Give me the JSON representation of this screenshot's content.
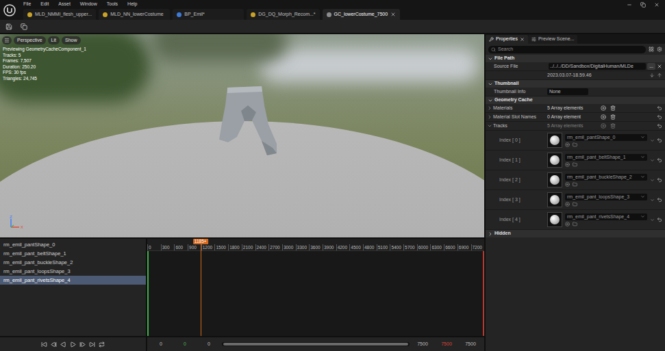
{
  "window": {
    "menu": [
      "File",
      "Edit",
      "Asset",
      "Window",
      "Tools",
      "Help"
    ]
  },
  "tabs": [
    {
      "label": "MLD_NMMI_flesh_upper...",
      "selected": false,
      "color": "#c9a227"
    },
    {
      "label": "MLD_NN_lowerCostume",
      "selected": false,
      "color": "#c9a227"
    },
    {
      "label": "BP_Emil*",
      "selected": false,
      "color": "#3d7bd6"
    },
    {
      "label": "DG_DQ_Morph_Recom...*",
      "selected": false,
      "color": "#c9a227"
    },
    {
      "label": "GC_lowerCostume_7500",
      "selected": true,
      "color": "#8c8c8c"
    }
  ],
  "viewport": {
    "buttons": [
      "Perspective",
      "Lit",
      "Show"
    ],
    "info": [
      "Previewing GeometryCacheComponent_1",
      "Tracks: 5",
      "Frames: 7,507",
      "Duration: 250.20",
      "FPS: 30 fps",
      "Triangles: 24,745"
    ],
    "axes": [
      {
        "label": "Z",
        "color": "#3b7cff"
      },
      {
        "label": "X",
        "color": "#e04b3b"
      }
    ]
  },
  "sequencer": {
    "tracks": [
      {
        "name": "rm_emil_pantShape_0",
        "selected": false
      },
      {
        "name": "rm_emil_pant_beltShape_1",
        "selected": false
      },
      {
        "name": "rm_emil_pant_buckleShape_2",
        "selected": false
      },
      {
        "name": "rm_emil_pant_loopsShape_3",
        "selected": false
      },
      {
        "name": "rm_emil_pant_rivetsShape_4",
        "selected": true
      }
    ],
    "ruler": [
      "0",
      "300",
      "600",
      "900",
      "1200",
      "1500",
      "1800",
      "2100",
      "2400",
      "2700",
      "3000",
      "3300",
      "3600",
      "3900",
      "4200",
      "4500",
      "4800",
      "5100",
      "5400",
      "5700",
      "6000",
      "6300",
      "6600",
      "6900",
      "7200"
    ],
    "playhead": {
      "label": "1185+",
      "level": 0.158
    },
    "range_start": [
      {
        "value": "0",
        "color": "#bdbdbd"
      },
      {
        "value": "0",
        "color": "#4caf50"
      },
      {
        "value": "0",
        "color": "#bdbdbd"
      }
    ],
    "range_end": [
      {
        "value": "7500",
        "color": "#bdbdbd"
      },
      {
        "value": "7500",
        "color": "#d9443a"
      },
      {
        "value": "7500",
        "color": "#bdbdbd"
      }
    ]
  },
  "details": {
    "tabs": [
      {
        "label": "Properties",
        "selected": true
      },
      {
        "label": "Preview Scene...",
        "selected": false
      }
    ],
    "search": {
      "placeholder": "Search"
    },
    "sections": [
      {
        "title": "File Path",
        "expanded": true,
        "rows": [
          {
            "kind": "file",
            "label": "Source File",
            "value": "../../../DD/Sandbox/DigitalHuman/MLDe",
            "button": "..."
          },
          {
            "kind": "timestamp",
            "value": "2023.03.07-18.59.46"
          }
        ]
      },
      {
        "title": "Thumbnail",
        "expanded": true,
        "rows": [
          {
            "kind": "text",
            "label": "Thumbnail Info",
            "value": "None"
          }
        ]
      },
      {
        "title": "Geometry Cache",
        "expanded": true,
        "rows": [
          {
            "kind": "array",
            "label": "Materials",
            "value": "5 Array elements",
            "expanded": false,
            "disabled": false
          },
          {
            "kind": "array",
            "label": "Material Slot Names",
            "value": "0 Array element",
            "expanded": false,
            "disabled": false
          },
          {
            "kind": "array",
            "label": "Tracks",
            "value": "5 Array elements",
            "expanded": true,
            "disabled": true
          },
          {
            "kind": "asset",
            "label": "Index [ 0 ]",
            "value": "rm_emil_pantShape_0"
          },
          {
            "kind": "asset",
            "label": "Index [ 1 ]",
            "value": "rm_emil_pant_beltShape_1"
          },
          {
            "kind": "asset",
            "label": "Index [ 2 ]",
            "value": "rm_emil_pant_buckleShape_2"
          },
          {
            "kind": "asset",
            "label": "Index [ 3 ]",
            "value": "rm_emil_pant_loopsShape_3"
          },
          {
            "kind": "asset",
            "label": "Index [ 4 ]",
            "value": "rm_emil_pant_rivetsShape_4"
          }
        ]
      },
      {
        "title": "Hidden",
        "expanded": false,
        "rows": []
      }
    ]
  }
}
